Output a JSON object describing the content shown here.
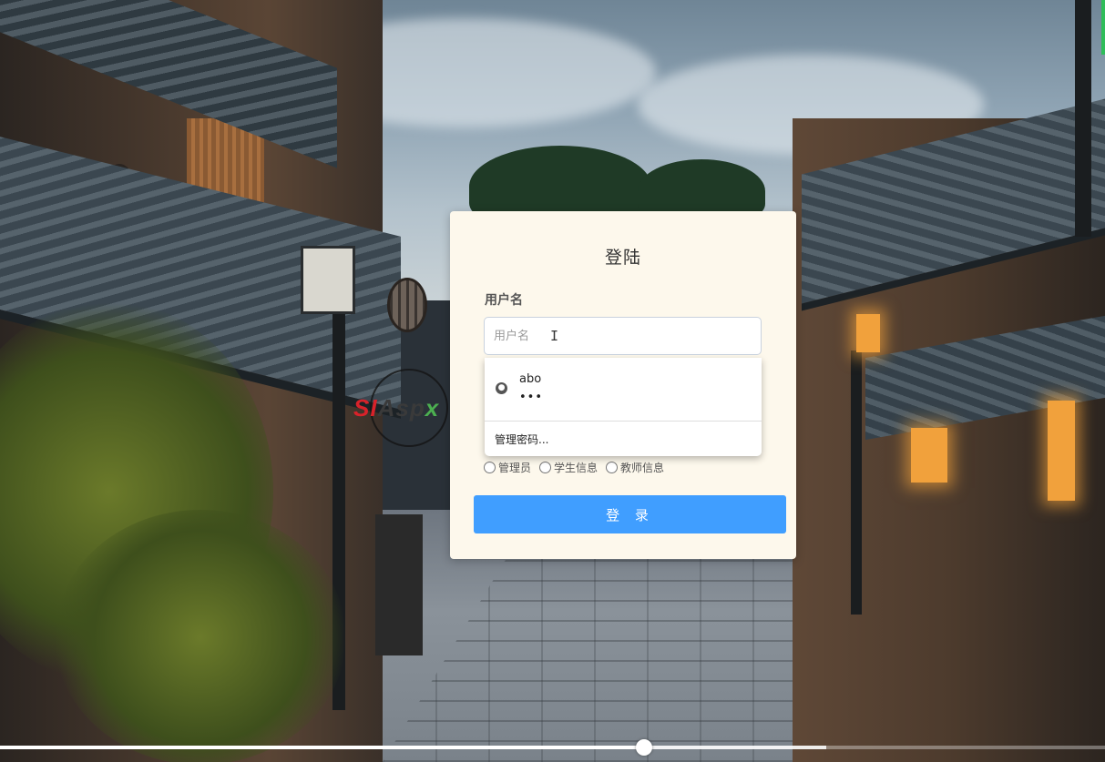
{
  "login": {
    "title": "登陆",
    "username_label": "用户名",
    "username_placeholder": "用户名",
    "username_value": "",
    "roles": [
      {
        "label": "管理员",
        "checked": false
      },
      {
        "label": "学生信息",
        "checked": false
      },
      {
        "label": "教师信息",
        "checked": false
      }
    ],
    "submit_label": "登 录",
    "submit_color": "#409eff",
    "card_color": "#fdf8ec"
  },
  "autofill": {
    "icon": "globe-icon",
    "saved_username": "abo",
    "saved_password_mask": "•••",
    "manage_label": "管理密码..."
  },
  "watermark": {
    "text_red": "SI",
    "text_gray": "Asp",
    "text_green": "x"
  },
  "video": {
    "progress_fraction": 0.583,
    "buffered_fraction": 0.748
  }
}
